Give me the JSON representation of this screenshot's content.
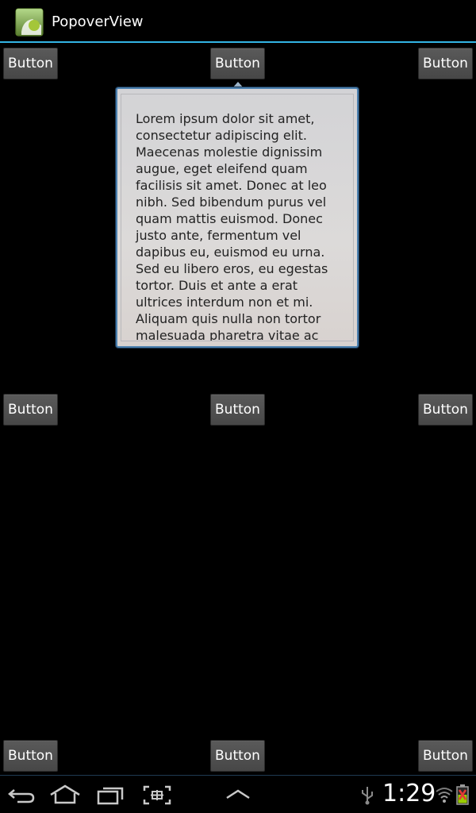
{
  "app": {
    "title": "PopoverView",
    "icon": "android-app-icon"
  },
  "buttons": {
    "top_left": "Button",
    "top_center": "Button",
    "top_right": "Button",
    "middle_left": "Button",
    "middle_center": "Button",
    "middle_right": "Button",
    "bottom_left": "Button",
    "bottom_center": "Button",
    "bottom_right": "Button"
  },
  "popover": {
    "text": "Lorem ipsum dolor sit amet, consectetur adipiscing elit. Maecenas molestie dignissim augue, eget eleifend quam facilisis sit amet. Donec at leo nibh. Sed bibendum purus vel quam mattis euismod. Donec justo ante, fermentum vel dapibus eu, euismod eu urna. Sed eu libero eros, eu egestas tortor. Duis et ante a erat ultrices interdum non et mi. Aliquam quis nulla non tortor malesuada pharetra vitae ac magna. Sed id"
  },
  "system_bar": {
    "time": "1:29",
    "icons": [
      "back-icon",
      "home-icon",
      "recent-apps-icon",
      "screenshot-icon",
      "menu-up-icon",
      "usb-icon",
      "wifi-icon",
      "battery-icon"
    ]
  },
  "colors": {
    "accent": "#33b5e5",
    "popover_border": "#4a7fae",
    "button_bg": "#4f4f4f",
    "background": "#000000"
  }
}
